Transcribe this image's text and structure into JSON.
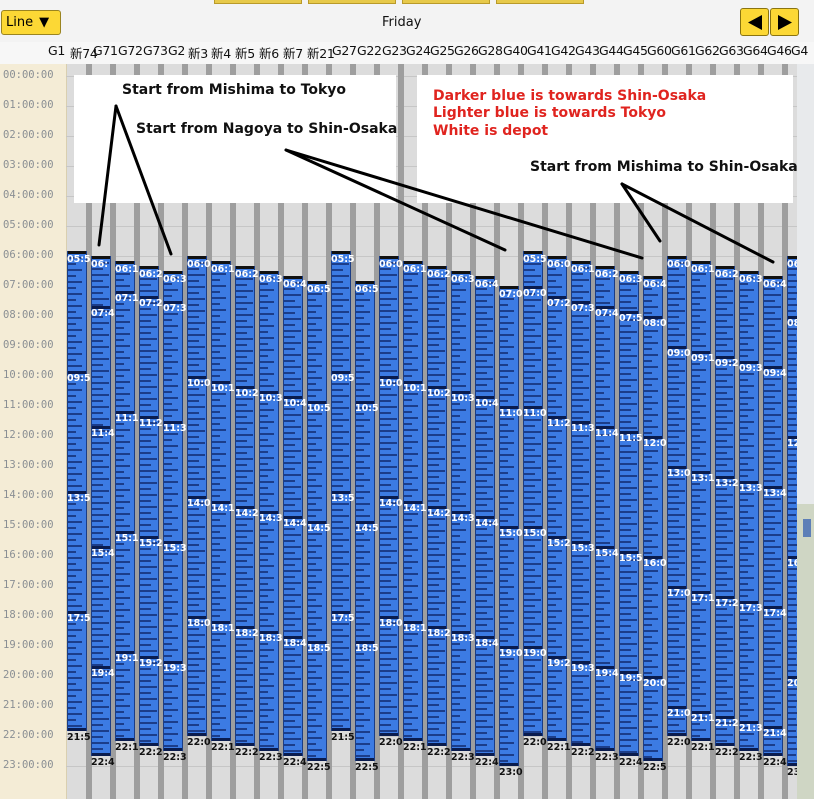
{
  "toolbar": {
    "line_label": "Line",
    "day": "Friday",
    "prev_icon": "arrow-left-icon",
    "next_icon": "arrow-right-icon"
  },
  "columns": [
    "G1",
    "新74",
    "G71",
    "G72",
    "G73",
    "G2",
    "新3",
    "新4",
    "新5",
    "新6",
    "新7",
    "新21",
    "G27",
    "G22",
    "G23",
    "G24",
    "G25",
    "G26",
    "G28",
    "G40",
    "G41",
    "G42",
    "G43",
    "G44",
    "G45",
    "G60",
    "G61",
    "G62",
    "G63",
    "G64",
    "G46",
    "G4"
  ],
  "time_axis": [
    "00:00:00",
    "01:00:00",
    "02:00:00",
    "03:00:00",
    "04:00:00",
    "05:00:00",
    "06:00:00",
    "07:00:00",
    "08:00:00",
    "09:00:00",
    "10:00:00",
    "11:00:00",
    "12:00:00",
    "13:00:00",
    "14:00:00",
    "15:00:00",
    "16:00:00",
    "17:00:00",
    "18:00:00",
    "19:00:00",
    "20:00:00",
    "21:00:00",
    "22:00:00",
    "23:00:00"
  ],
  "trains": [
    {
      "start": "05:5",
      "end": "21:5",
      "mids": [
        "09:5",
        "13:5",
        "17:5"
      ]
    },
    {
      "start": "06:",
      "end": "22:4",
      "mids": [
        "07:4",
        "11:4",
        "15:4",
        "19:4"
      ]
    },
    {
      "start": "06:1",
      "end": "22:1",
      "mids": [
        "07:1",
        "11:1",
        "15:1",
        "19:1"
      ]
    },
    {
      "start": "06:2",
      "end": "22:2",
      "mids": [
        "07:2",
        "11:2",
        "15:2",
        "19:2"
      ]
    },
    {
      "start": "06:3",
      "end": "22:3",
      "mids": [
        "07:3",
        "11:3",
        "15:3",
        "19:3"
      ]
    },
    {
      "start": "06:0",
      "end": "22:0",
      "mids": [
        "10:0",
        "14:0",
        "18:0"
      ]
    },
    {
      "start": "06:1",
      "end": "22:1",
      "mids": [
        "10:1",
        "14:1",
        "18:1"
      ]
    },
    {
      "start": "06:2",
      "end": "22:2",
      "mids": [
        "10:2",
        "14:2",
        "18:2"
      ]
    },
    {
      "start": "06:3",
      "end": "22:3",
      "mids": [
        "10:3",
        "14:3",
        "18:3"
      ]
    },
    {
      "start": "06:4",
      "end": "22:4",
      "mids": [
        "10:4",
        "14:4",
        "18:4"
      ]
    },
    {
      "start": "06:5",
      "end": "22:5",
      "mids": [
        "10:5",
        "14:5",
        "18:5"
      ]
    },
    {
      "start": "05:5",
      "end": "21:5",
      "mids": [
        "09:5",
        "13:5",
        "17:5"
      ]
    },
    {
      "start": "06:5",
      "end": "22:5",
      "mids": [
        "10:5",
        "14:5",
        "18:5"
      ]
    },
    {
      "start": "06:0",
      "end": "22:0",
      "mids": [
        "10:0",
        "14:0",
        "18:0"
      ]
    },
    {
      "start": "06:1",
      "end": "22:1",
      "mids": [
        "10:1",
        "14:1",
        "18:1"
      ]
    },
    {
      "start": "06:2",
      "end": "22:2",
      "mids": [
        "10:2",
        "14:2",
        "18:2"
      ]
    },
    {
      "start": "06:3",
      "end": "22:3",
      "mids": [
        "10:3",
        "14:3",
        "18:3"
      ]
    },
    {
      "start": "06:4",
      "end": "22:4",
      "mids": [
        "10:4",
        "14:4",
        "18:4"
      ]
    },
    {
      "start": "07:0",
      "end": "23:0",
      "mids": [
        "11:0",
        "15:0",
        "19:0"
      ]
    },
    {
      "start": "05:5",
      "end": "22:0",
      "mids": [
        "07:0",
        "11:0",
        "15:0",
        "19:0"
      ]
    },
    {
      "start": "06:0",
      "end": "22:1",
      "mids": [
        "07:2",
        "11:2",
        "15:2",
        "19:2"
      ]
    },
    {
      "start": "06:1",
      "end": "22:2",
      "mids": [
        "07:3",
        "11:3",
        "15:3",
        "19:3"
      ]
    },
    {
      "start": "06:2",
      "end": "22:3",
      "mids": [
        "07:4",
        "11:4",
        "15:4",
        "19:4"
      ]
    },
    {
      "start": "06:3",
      "end": "22:4",
      "mids": [
        "07:5",
        "11:5",
        "15:5",
        "19:5"
      ]
    },
    {
      "start": "06:4",
      "end": "22:5",
      "mids": [
        "08:0",
        "12:0",
        "16:0",
        "20:0"
      ]
    },
    {
      "start": "06:0",
      "end": "22:0",
      "mids": [
        "09:0",
        "13:0",
        "17:0",
        "21:0"
      ]
    },
    {
      "start": "06:1",
      "end": "22:1",
      "mids": [
        "09:1",
        "13:1",
        "17:1",
        "21:1"
      ]
    },
    {
      "start": "06:2",
      "end": "22:2",
      "mids": [
        "09:2",
        "13:2",
        "17:2",
        "21:2"
      ]
    },
    {
      "start": "06:3",
      "end": "22:3",
      "mids": [
        "09:3",
        "13:3",
        "17:3",
        "21:3"
      ]
    },
    {
      "start": "06:4",
      "end": "22:4",
      "mids": [
        "09:4",
        "13:4",
        "17:4",
        "21:4"
      ]
    },
    {
      "start": "06:",
      "end": "23:",
      "mids": [
        "08:",
        "12:",
        "16:",
        "20:"
      ]
    }
  ],
  "annotations": {
    "a1": "Start from Mishima to Tokyo",
    "a2": "Start from Nagoya to Shin-Osaka",
    "a3": "Start from Mishima to Shin-Osaka"
  },
  "legend": {
    "l1": "Darker blue is towards Shin-Osaka",
    "l2": "Lighter blue is towards Tokyo",
    "l3": "White is depot",
    "color": "#e0241f"
  },
  "colors": {
    "train": "#3c7be3",
    "train_dark": "#1b3d85",
    "toolbar_button": "#fcd835"
  }
}
